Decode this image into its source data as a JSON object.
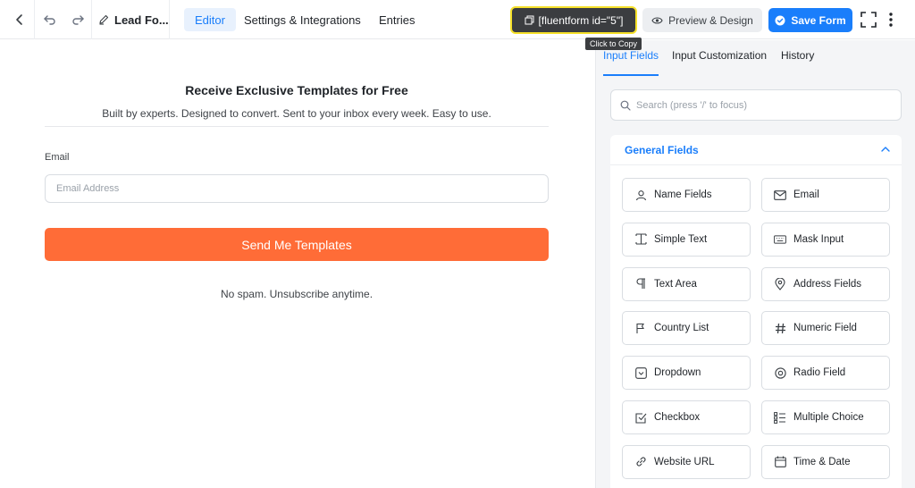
{
  "topbar": {
    "form_title": "Lead Fo...",
    "tabs": [
      "Editor",
      "Settings & Integrations",
      "Entries"
    ],
    "shortcode": "[fluentform id=\"5\"]",
    "tooltip": "Click to Copy",
    "preview_label": "Preview & Design",
    "save_label": "Save Form"
  },
  "form": {
    "heading": "Receive Exclusive Templates for Free",
    "subheading": "Built by experts. Designed to convert. Sent to your inbox every week. Easy to use.",
    "email_label": "Email",
    "email_placeholder": "Email Address",
    "submit_label": "Send Me Templates",
    "footer_note": "No spam. Unsubscribe anytime."
  },
  "panel": {
    "tabs": [
      "Input Fields",
      "Input Customization",
      "History"
    ],
    "search_placeholder": "Search (press '/' to focus)",
    "section_title": "General Fields",
    "fields": [
      {
        "label": "Name Fields",
        "icon": "user-icon"
      },
      {
        "label": "Email",
        "icon": "envelope-icon"
      },
      {
        "label": "Simple Text",
        "icon": "text-cursor-icon"
      },
      {
        "label": "Mask Input",
        "icon": "keyboard-icon"
      },
      {
        "label": "Text Area",
        "icon": "paragraph-icon"
      },
      {
        "label": "Address Fields",
        "icon": "map-pin-icon"
      },
      {
        "label": "Country List",
        "icon": "flag-icon"
      },
      {
        "label": "Numeric Field",
        "icon": "hash-icon"
      },
      {
        "label": "Dropdown",
        "icon": "dropdown-icon"
      },
      {
        "label": "Radio Field",
        "icon": "radio-icon"
      },
      {
        "label": "Checkbox",
        "icon": "checkbox-icon"
      },
      {
        "label": "Multiple Choice",
        "icon": "list-icon"
      },
      {
        "label": "Website URL",
        "icon": "link-icon"
      },
      {
        "label": "Time & Date",
        "icon": "calendar-icon"
      }
    ]
  },
  "colors": {
    "accent": "#1a7efb",
    "submit": "#ff6c37",
    "shortcode_bg": "#3b3d40",
    "shortcode_border": "#f5e029"
  }
}
